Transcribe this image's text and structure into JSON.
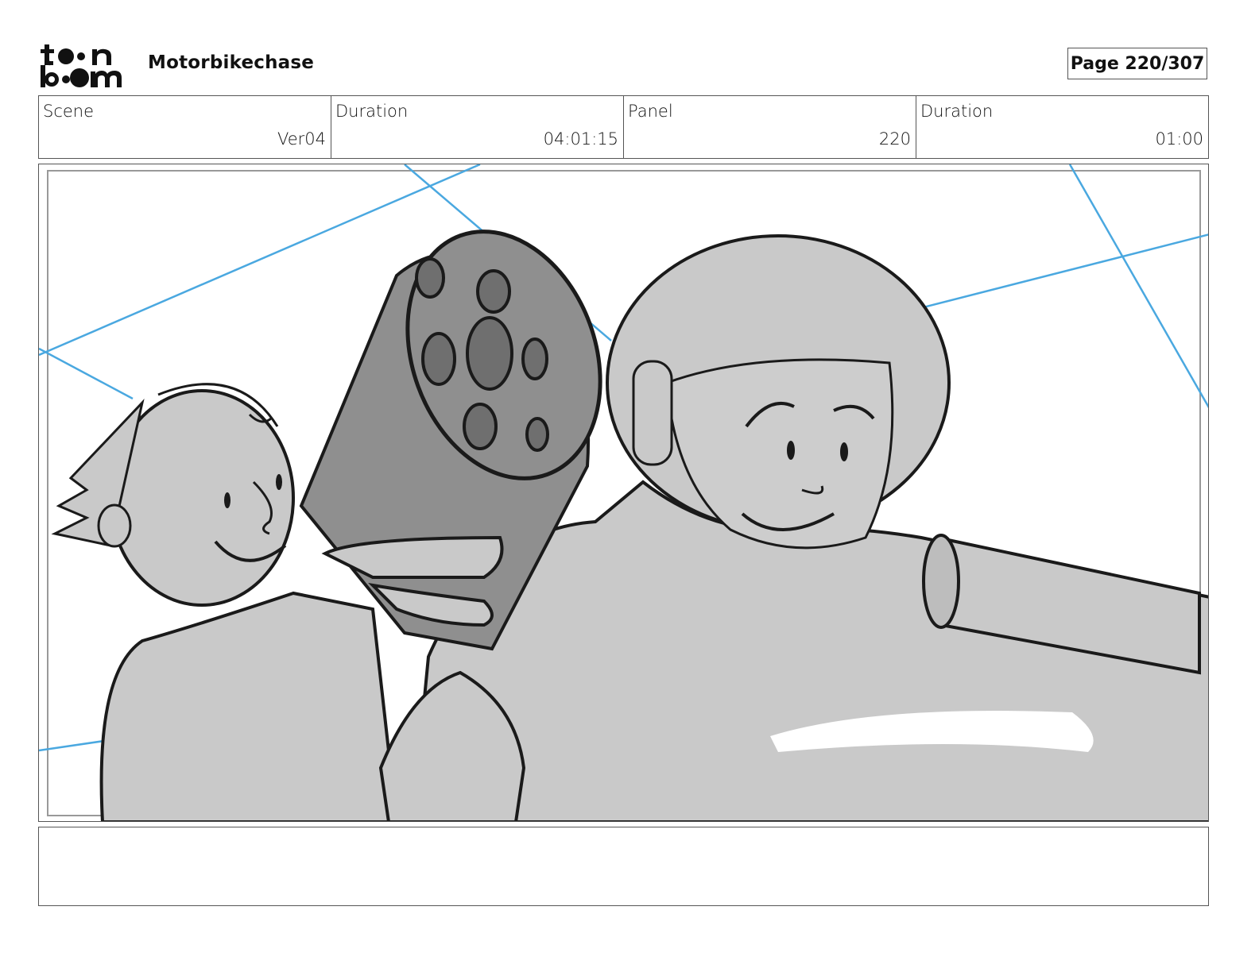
{
  "header": {
    "logo_text_top": "toon",
    "logo_text_bottom": "boom",
    "project_title": "Motorbikechase",
    "page_label": "Page 220/307"
  },
  "info": [
    {
      "label": "Scene",
      "value": "Ver04"
    },
    {
      "label": "Duration",
      "value": "04:01:15"
    },
    {
      "label": "Panel",
      "value": "220"
    },
    {
      "label": "Duration",
      "value": "01:00"
    }
  ],
  "panel": {
    "image_name": "storyboard-sketch",
    "guide_color": "#4aa8e0",
    "fill_light": "#c9c9c9",
    "fill_dark": "#8f8f8f",
    "line_color": "#1a1a1a"
  },
  "notes": {
    "text": ""
  }
}
